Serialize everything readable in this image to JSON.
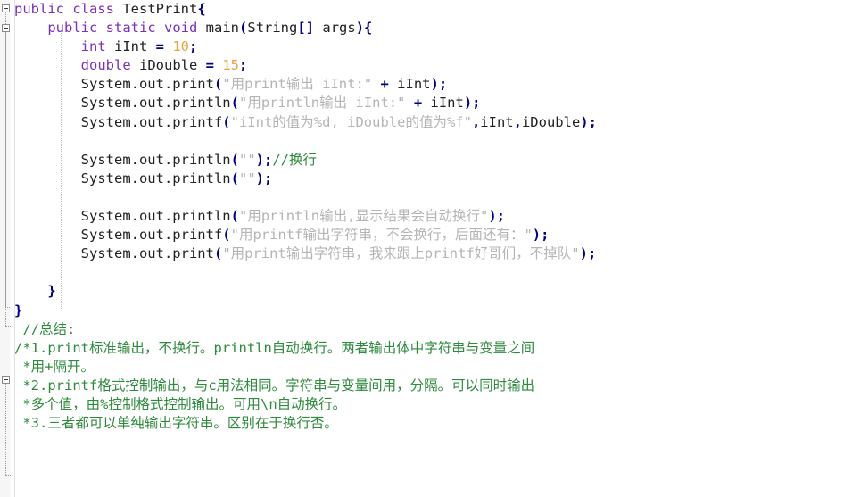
{
  "app": {
    "kind": "code-editor",
    "language": "Java",
    "class_name": "TestPrint"
  },
  "theme": {
    "background": "#ffffff",
    "gutter_background": "#f6f6f6",
    "keyword": "#7b2fbe",
    "number": "#e8a33d",
    "string": "#b5b5b5",
    "comment": "#2e8b3d",
    "punctuation": "#00008b",
    "text": "#222222"
  },
  "gutter": {
    "fold_markers": [
      {
        "name": "fold-class",
        "state": "expanded",
        "glyph": "minus"
      },
      {
        "name": "fold-main-method",
        "state": "expanded",
        "glyph": "minus"
      },
      {
        "name": "fold-block-comment",
        "state": "expanded",
        "glyph": "minus"
      }
    ]
  },
  "code": {
    "lines": [
      {
        "id": 1,
        "indent": 0,
        "tokens": [
          {
            "t": "public",
            "c": "kw"
          },
          {
            "t": " ",
            "c": "plain"
          },
          {
            "t": "class",
            "c": "kw"
          },
          {
            "t": " TestPrint",
            "c": "plain"
          },
          {
            "t": "{",
            "c": "punct"
          }
        ]
      },
      {
        "id": 2,
        "indent": 1,
        "tokens": [
          {
            "t": "public",
            "c": "kw"
          },
          {
            "t": " ",
            "c": "plain"
          },
          {
            "t": "static",
            "c": "kw"
          },
          {
            "t": " ",
            "c": "plain"
          },
          {
            "t": "void",
            "c": "kw"
          },
          {
            "t": " main",
            "c": "plain"
          },
          {
            "t": "(",
            "c": "punct"
          },
          {
            "t": "String",
            "c": "plain"
          },
          {
            "t": "[]",
            "c": "punct"
          },
          {
            "t": " args",
            "c": "plain"
          },
          {
            "t": "){",
            "c": "punct"
          }
        ]
      },
      {
        "id": 3,
        "indent": 2,
        "tokens": [
          {
            "t": "int",
            "c": "kw"
          },
          {
            "t": " iInt ",
            "c": "plain"
          },
          {
            "t": "=",
            "c": "op"
          },
          {
            "t": " ",
            "c": "plain"
          },
          {
            "t": "10",
            "c": "num"
          },
          {
            "t": ";",
            "c": "punct"
          }
        ]
      },
      {
        "id": 4,
        "indent": 2,
        "tokens": [
          {
            "t": "double",
            "c": "kw"
          },
          {
            "t": " iDouble ",
            "c": "plain"
          },
          {
            "t": "=",
            "c": "op"
          },
          {
            "t": " ",
            "c": "plain"
          },
          {
            "t": "15",
            "c": "num"
          },
          {
            "t": ";",
            "c": "punct"
          }
        ]
      },
      {
        "id": 5,
        "indent": 2,
        "tokens": [
          {
            "t": "System.out.print",
            "c": "plain"
          },
          {
            "t": "(",
            "c": "punct"
          },
          {
            "t": "\"用print输出 iInt:\"",
            "c": "str"
          },
          {
            "t": " ",
            "c": "plain"
          },
          {
            "t": "+",
            "c": "op"
          },
          {
            "t": " iInt",
            "c": "plain"
          },
          {
            "t": ");",
            "c": "punct"
          }
        ]
      },
      {
        "id": 6,
        "indent": 2,
        "tokens": [
          {
            "t": "System.out.println",
            "c": "plain"
          },
          {
            "t": "(",
            "c": "punct"
          },
          {
            "t": "\"用println输出 iInt:\"",
            "c": "str"
          },
          {
            "t": " ",
            "c": "plain"
          },
          {
            "t": "+",
            "c": "op"
          },
          {
            "t": " iInt",
            "c": "plain"
          },
          {
            "t": ");",
            "c": "punct"
          }
        ]
      },
      {
        "id": 7,
        "indent": 2,
        "tokens": [
          {
            "t": "System.out.printf",
            "c": "plain"
          },
          {
            "t": "(",
            "c": "punct"
          },
          {
            "t": "\"iInt的值为%d, iDouble的值为%f\"",
            "c": "str"
          },
          {
            "t": ",",
            "c": "punct"
          },
          {
            "t": "iInt",
            "c": "plain"
          },
          {
            "t": ",",
            "c": "punct"
          },
          {
            "t": "iDouble",
            "c": "plain"
          },
          {
            "t": ");",
            "c": "punct"
          }
        ]
      },
      {
        "id": 8,
        "indent": 2,
        "tokens": []
      },
      {
        "id": 9,
        "indent": 2,
        "tokens": [
          {
            "t": "System.out.println",
            "c": "plain"
          },
          {
            "t": "(",
            "c": "punct"
          },
          {
            "t": "\"\"",
            "c": "str"
          },
          {
            "t": ");",
            "c": "punct"
          },
          {
            "t": "//换行",
            "c": "cmt"
          }
        ]
      },
      {
        "id": 10,
        "indent": 2,
        "tokens": [
          {
            "t": "System.out.println",
            "c": "plain"
          },
          {
            "t": "(",
            "c": "punct"
          },
          {
            "t": "\"\"",
            "c": "str"
          },
          {
            "t": ");",
            "c": "punct"
          }
        ]
      },
      {
        "id": 11,
        "indent": 2,
        "tokens": []
      },
      {
        "id": 12,
        "indent": 2,
        "tokens": [
          {
            "t": "System.out.println",
            "c": "plain"
          },
          {
            "t": "(",
            "c": "punct"
          },
          {
            "t": "\"用println输出,显示结果会自动换行\"",
            "c": "str"
          },
          {
            "t": ");",
            "c": "punct"
          }
        ]
      },
      {
        "id": 13,
        "indent": 2,
        "tokens": [
          {
            "t": "System.out.printf",
            "c": "plain"
          },
          {
            "t": "(",
            "c": "punct"
          },
          {
            "t": "\"用printf输出字符串，不会换行，后面还有：\"",
            "c": "str"
          },
          {
            "t": ");",
            "c": "punct"
          }
        ]
      },
      {
        "id": 14,
        "indent": 2,
        "tokens": [
          {
            "t": "System.out.print",
            "c": "plain"
          },
          {
            "t": "(",
            "c": "punct"
          },
          {
            "t": "\"用print输出字符串，我来跟上printf好哥们，不掉队\"",
            "c": "str"
          },
          {
            "t": ");",
            "c": "punct"
          }
        ]
      },
      {
        "id": 15,
        "indent": 0,
        "tokens": []
      },
      {
        "id": 16,
        "indent": 1,
        "tokens": [
          {
            "t": "}",
            "c": "punct"
          }
        ]
      },
      {
        "id": 17,
        "indent": 0,
        "tokens": [
          {
            "t": "}",
            "c": "punct"
          }
        ]
      },
      {
        "id": 18,
        "indent": 0,
        "tokens": [
          {
            "t": " //总结:",
            "c": "cmt"
          }
        ]
      },
      {
        "id": 19,
        "indent": 0,
        "tokens": [
          {
            "t": "/*1.print标准输出，不换行。println自动换行。两者输出体中字符串与变量之间",
            "c": "cmt"
          }
        ]
      },
      {
        "id": 20,
        "indent": 0,
        "tokens": [
          {
            "t": " *用+隔开。",
            "c": "cmt"
          }
        ]
      },
      {
        "id": 21,
        "indent": 0,
        "tokens": [
          {
            "t": " *2.printf格式控制输出，与c用法相同。字符串与变量间用，分隔。可以同时输出",
            "c": "cmt"
          }
        ]
      },
      {
        "id": 22,
        "indent": 0,
        "tokens": [
          {
            "t": " *多个值，由%控制格式控制输出。可用\\n自动换行。",
            "c": "cmt"
          }
        ]
      },
      {
        "id": 23,
        "indent": 0,
        "tokens": [
          {
            "t": " *3.三者都可以单纯输出字符串。区别在于换行否。",
            "c": "cmt"
          }
        ]
      }
    ]
  }
}
